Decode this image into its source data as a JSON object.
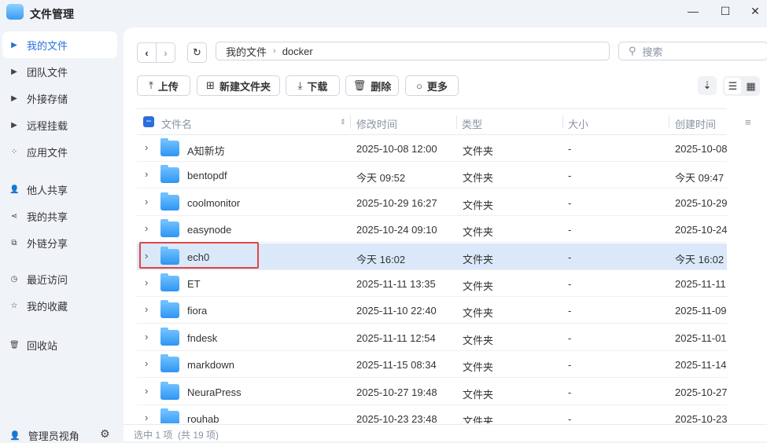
{
  "app": {
    "title": "文件管理"
  },
  "window": {
    "minimize": "—",
    "maximize": "☐",
    "close": "✕"
  },
  "sidebar": {
    "items": [
      {
        "label": "我的文件",
        "icon": "caret-right-icon"
      },
      {
        "label": "团队文件",
        "icon": "caret-right-icon"
      },
      {
        "label": "外接存储",
        "icon": "caret-right-icon"
      },
      {
        "label": "远程挂载",
        "icon": "caret-right-icon"
      },
      {
        "label": "应用文件",
        "icon": "apps-icon"
      },
      {
        "label": "他人共享",
        "icon": "user-icon"
      },
      {
        "label": "我的共享",
        "icon": "share-icon"
      },
      {
        "label": "外链分享",
        "icon": "external-link-icon"
      },
      {
        "label": "最近访问",
        "icon": "clock-icon"
      },
      {
        "label": "我的收藏",
        "icon": "star-icon"
      },
      {
        "label": "回收站",
        "icon": "trash-icon"
      }
    ],
    "admin": "管理员视角"
  },
  "breadcrumb": [
    "我的文件",
    "docker"
  ],
  "search": {
    "placeholder": "搜索"
  },
  "toolbar": {
    "upload": "上传",
    "new_folder": "新建文件夹",
    "download": "下载",
    "delete": "删除",
    "more": "更多"
  },
  "columns": {
    "name": "文件名",
    "modified": "修改时间",
    "type": "类型",
    "size": "大小",
    "created": "创建时间"
  },
  "rows": [
    {
      "name": "A知新坊",
      "modified": "2025-10-08 12:00",
      "type": "文件夹",
      "size": "-",
      "created": "2025-10-08"
    },
    {
      "name": "bentopdf",
      "modified": "今天 09:52",
      "type": "文件夹",
      "size": "-",
      "created": "今天 09:47"
    },
    {
      "name": "coolmonitor",
      "modified": "2025-10-29 16:27",
      "type": "文件夹",
      "size": "-",
      "created": "2025-10-29"
    },
    {
      "name": "easynode",
      "modified": "2025-10-24 09:10",
      "type": "文件夹",
      "size": "-",
      "created": "2025-10-24"
    },
    {
      "name": "ech0",
      "modified": "今天 16:02",
      "type": "文件夹",
      "size": "-",
      "created": "今天 16:02",
      "selected": true
    },
    {
      "name": "ET",
      "modified": "2025-11-11 13:35",
      "type": "文件夹",
      "size": "-",
      "created": "2025-11-11"
    },
    {
      "name": "fiora",
      "modified": "2025-11-10 22:40",
      "type": "文件夹",
      "size": "-",
      "created": "2025-11-09"
    },
    {
      "name": "fndesk",
      "modified": "2025-11-11 12:54",
      "type": "文件夹",
      "size": "-",
      "created": "2025-11-01"
    },
    {
      "name": "markdown",
      "modified": "2025-11-15 08:34",
      "type": "文件夹",
      "size": "-",
      "created": "2025-11-14"
    },
    {
      "name": "NeuraPress",
      "modified": "2025-10-27 19:48",
      "type": "文件夹",
      "size": "-",
      "created": "2025-10-27"
    },
    {
      "name": "rouhab",
      "modified": "2025-10-23 23:48",
      "type": "文件夹",
      "size": "-",
      "created": "2025-10-23"
    }
  ],
  "status": "选中 1 项  (共 19 项)",
  "colors": {
    "accent": "#2a6fdb",
    "selected_row": "#dbe8fa",
    "highlight": "#e04545"
  }
}
